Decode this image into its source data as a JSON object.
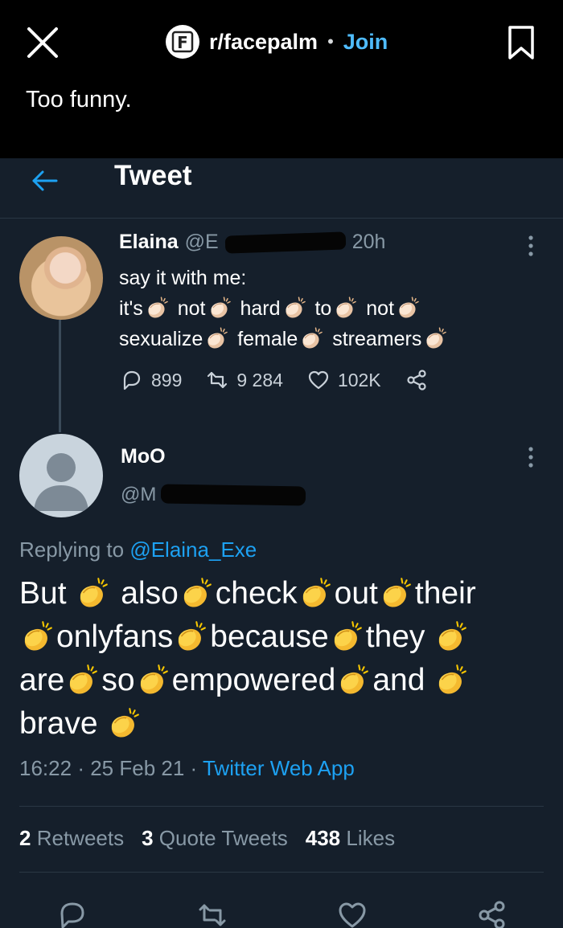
{
  "reddit": {
    "subreddit": "r/facepalm",
    "separator": "•",
    "join_label": "Join",
    "post_title": "Too funny.",
    "logo_letter": "F"
  },
  "tweet_header": {
    "title": "Tweet"
  },
  "original_tweet": {
    "author_name": "Elaina",
    "author_handle_visible": "@E",
    "time": "20h",
    "line1": "say it with me:",
    "words_line2": [
      "it's",
      "not",
      "hard",
      "to",
      "not"
    ],
    "words_line3": [
      "sexualize",
      "female",
      "streamers"
    ],
    "replies": "899",
    "retweets": "9 284",
    "likes": "102K"
  },
  "reply_tweet": {
    "author_name": "MoO",
    "author_handle_visible": "@M",
    "replying_prefix": "Replying to",
    "replying_to": "@Elaina_Exe",
    "words": [
      "But",
      "also",
      "check",
      "out",
      "their",
      "onlyfans",
      "because",
      "they",
      "are",
      "so",
      "empowered",
      "and",
      "brave"
    ],
    "time": "16:22",
    "date": "25 Feb 21",
    "meta_sep": "·",
    "source": "Twitter Web App",
    "retweets_count": "2",
    "retweets_label": "Retweets",
    "quotes_count": "3",
    "quotes_label": "Quote Tweets",
    "likes_count": "438",
    "likes_label": "Likes"
  },
  "colors": {
    "background": "#151f2b",
    "accent": "#1da1f2",
    "muted": "#8899a6",
    "join": "#4fbcff"
  },
  "icons": [
    "close-icon",
    "bookmark-icon",
    "back-arrow-icon",
    "more-icon",
    "reply-icon",
    "retweet-icon",
    "like-icon",
    "share-icon",
    "clapping-hands-emoji"
  ]
}
